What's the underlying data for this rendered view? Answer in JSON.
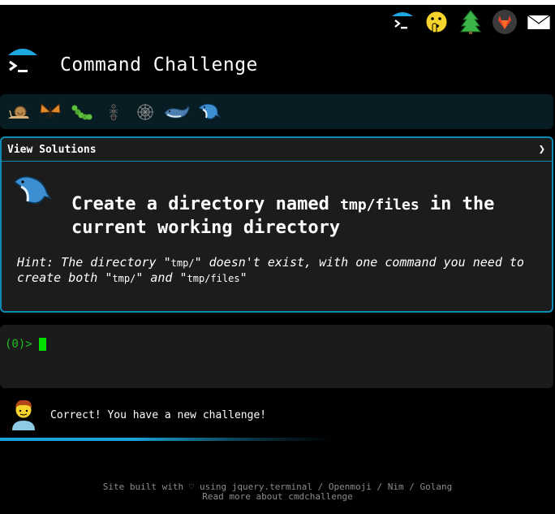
{
  "header": {
    "title": "Command Challenge",
    "logo_icon": "terminal-umbrella-icon",
    "top_icons": [
      "terminal-icon",
      "shushing-face-icon",
      "pine-tree-icon",
      "gitlab-icon",
      "envelope-icon"
    ]
  },
  "levels": [
    "snail-icon",
    "butterfly-icon",
    "caterpillar-icon",
    "ant-icon",
    "spider-web-icon",
    "whale-icon",
    "dolphin-icon"
  ],
  "panel": {
    "solutions_label": "View Solutions",
    "chevron": "❯",
    "title_before": "Create a directory named ",
    "title_code": "tmp/files",
    "title_after": " in the current working directory",
    "hint_prefix": "Hint: The directory \"",
    "hint_code1": "tmp/",
    "hint_mid1": "\" doesn't exist, with one command you need to create both \"",
    "hint_code2": "tmp/",
    "hint_mid2": "\" and \"",
    "hint_code3": "tmp/files",
    "hint_end": "\""
  },
  "terminal": {
    "prompt": "(0)>"
  },
  "message": {
    "text": "Correct! You have a new challenge!"
  },
  "footer": {
    "line1": "Site built with ♡ using jquery.terminal / Openmoji / Nim / Golang",
    "line2": "Read more about cmdchallenge"
  },
  "colors": {
    "accent": "#0e8bb5",
    "terminal_green": "#1fbf1f",
    "panel_bg": "#1c1c1c"
  }
}
